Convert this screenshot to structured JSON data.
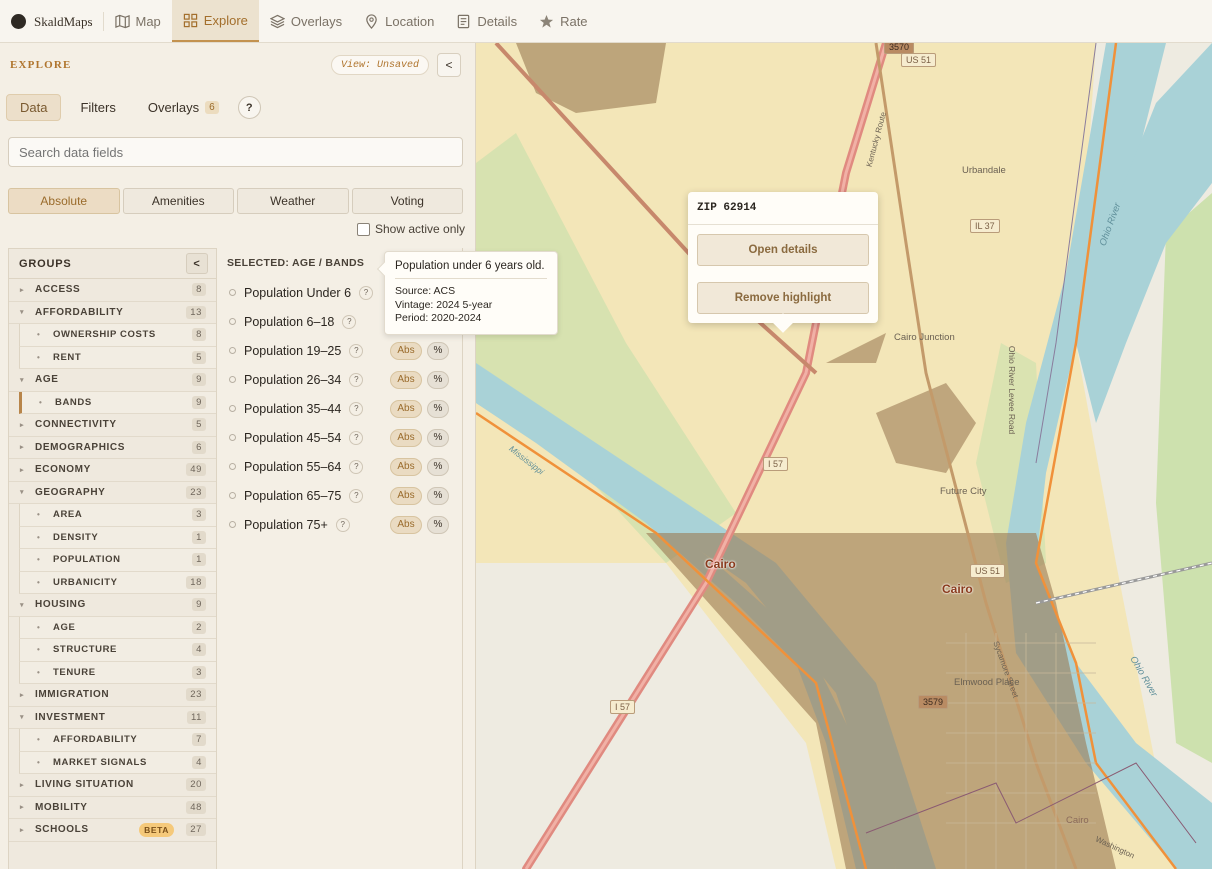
{
  "brand": {
    "name": "SkaldMaps"
  },
  "nav": [
    {
      "label": "Map",
      "icon": "map-icon"
    },
    {
      "label": "Explore",
      "icon": "grid-icon",
      "active": true
    },
    {
      "label": "Overlays",
      "icon": "layers-icon"
    },
    {
      "label": "Location",
      "icon": "pin-icon"
    },
    {
      "label": "Details",
      "icon": "document-icon"
    },
    {
      "label": "Rate",
      "icon": "star-icon"
    }
  ],
  "panel": {
    "title": "EXPLORE",
    "view_badge": "View: Unsaved",
    "collapse_label": "<",
    "subtabs": {
      "data": "Data",
      "filters": "Filters",
      "overlays": "Overlays",
      "overlays_count": "6",
      "help": "?"
    },
    "search_placeholder": "Search data fields",
    "modes": [
      "Absolute",
      "Amenities",
      "Weather",
      "Voting"
    ],
    "show_active_only": "Show active only"
  },
  "groups": {
    "header": "GROUPS",
    "collapse_label": "<",
    "items": [
      {
        "label": "ACCESS",
        "count": "8",
        "level": 0,
        "expanded": false
      },
      {
        "label": "AFFORDABILITY",
        "count": "13",
        "level": 0,
        "expanded": true
      },
      {
        "label": "OWNERSHIP COSTS",
        "count": "8",
        "level": 1
      },
      {
        "label": "RENT",
        "count": "5",
        "level": 1
      },
      {
        "label": "AGE",
        "count": "9",
        "level": 0,
        "expanded": true
      },
      {
        "label": "BANDS",
        "count": "9",
        "level": 1,
        "selected": true
      },
      {
        "label": "CONNECTIVITY",
        "count": "5",
        "level": 0,
        "expanded": false
      },
      {
        "label": "DEMOGRAPHICS",
        "count": "6",
        "level": 0,
        "expanded": false
      },
      {
        "label": "ECONOMY",
        "count": "49",
        "level": 0,
        "expanded": false
      },
      {
        "label": "GEOGRAPHY",
        "count": "23",
        "level": 0,
        "expanded": true
      },
      {
        "label": "AREA",
        "count": "3",
        "level": 1
      },
      {
        "label": "DENSITY",
        "count": "1",
        "level": 1
      },
      {
        "label": "POPULATION",
        "count": "1",
        "level": 1
      },
      {
        "label": "URBANICITY",
        "count": "18",
        "level": 1
      },
      {
        "label": "HOUSING",
        "count": "9",
        "level": 0,
        "expanded": true
      },
      {
        "label": "AGE",
        "count": "2",
        "level": 1
      },
      {
        "label": "STRUCTURE",
        "count": "4",
        "level": 1
      },
      {
        "label": "TENURE",
        "count": "3",
        "level": 1
      },
      {
        "label": "IMMIGRATION",
        "count": "23",
        "level": 0,
        "expanded": false
      },
      {
        "label": "INVESTMENT",
        "count": "11",
        "level": 0,
        "expanded": true
      },
      {
        "label": "AFFORDABILITY",
        "count": "7",
        "level": 1
      },
      {
        "label": "MARKET SIGNALS",
        "count": "4",
        "level": 1
      },
      {
        "label": "LIVING SITUATION",
        "count": "20",
        "level": 0,
        "expanded": false
      },
      {
        "label": "MOBILITY",
        "count": "48",
        "level": 0,
        "expanded": false
      },
      {
        "label": "SCHOOLS",
        "count": "27",
        "level": 0,
        "expanded": false,
        "badge": "BETA"
      }
    ]
  },
  "fields": {
    "header": "SELECTED: AGE / BANDS",
    "abs_label": "Abs",
    "pct_label": "%",
    "help": "?",
    "items": [
      {
        "label": "Population Under 6"
      },
      {
        "label": "Population 6–18"
      },
      {
        "label": "Population 19–25"
      },
      {
        "label": "Population 26–34"
      },
      {
        "label": "Population 35–44"
      },
      {
        "label": "Population 45–54"
      },
      {
        "label": "Population 55–64"
      },
      {
        "label": "Population 65–75"
      },
      {
        "label": "Population 75+"
      }
    ]
  },
  "tooltip": {
    "title": "Population under 6 years old.",
    "source": "Source: ACS",
    "vintage": "Vintage: 2024 5-year",
    "period": "Period: 2020-2024"
  },
  "popup": {
    "title": "ZIP 62914",
    "open_details": "Open details",
    "remove_highlight": "Remove highlight"
  },
  "map": {
    "labels": [
      "Urbandale",
      "Cairo Junction",
      "Future City",
      "Elmwood Place",
      "Ohio River",
      "Ohio River",
      "Mississippi",
      "Ohio River Levee Road",
      "Cairo",
      "Kentucky Route",
      "Sycamore Street",
      "Washington"
    ],
    "shields": [
      "US 51",
      "IL 37",
      "I 57",
      "US 51",
      "I 57",
      "3579",
      "3570"
    ],
    "cities": [
      "Cairo",
      "Cairo",
      "Cairo"
    ]
  },
  "colors": {
    "accent": "#b0752e",
    "map_land": "#f2e9cc",
    "river": "#a8d3d8",
    "highlight": "#a0825a",
    "boundary": "#f0913a"
  }
}
